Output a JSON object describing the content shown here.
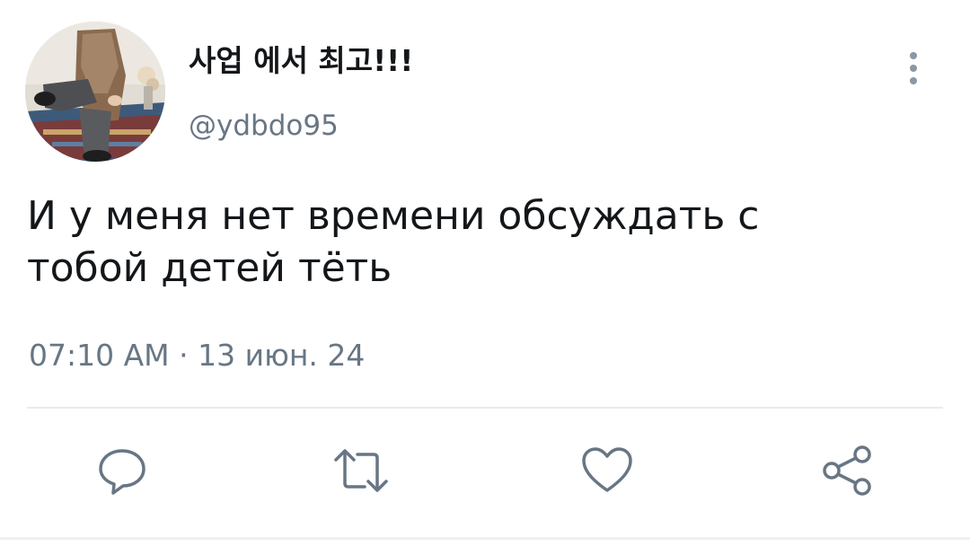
{
  "tweet": {
    "display_name": "사업 에서 최고!!!",
    "handle": "@ydbdo95",
    "text": "И у меня нет времени обсуждать с\nтобой детей тёть",
    "time": "07:10 AM",
    "separator": "·",
    "date": "13 июн. 24"
  },
  "actions": [
    {
      "icon": "reply-icon"
    },
    {
      "icon": "retweet-icon"
    },
    {
      "icon": "like-icon"
    },
    {
      "icon": "share-icon"
    }
  ],
  "colors": {
    "text": "#14171a",
    "secondary": "#687684",
    "icon": "#687684",
    "divider": "#e6ecf0"
  }
}
